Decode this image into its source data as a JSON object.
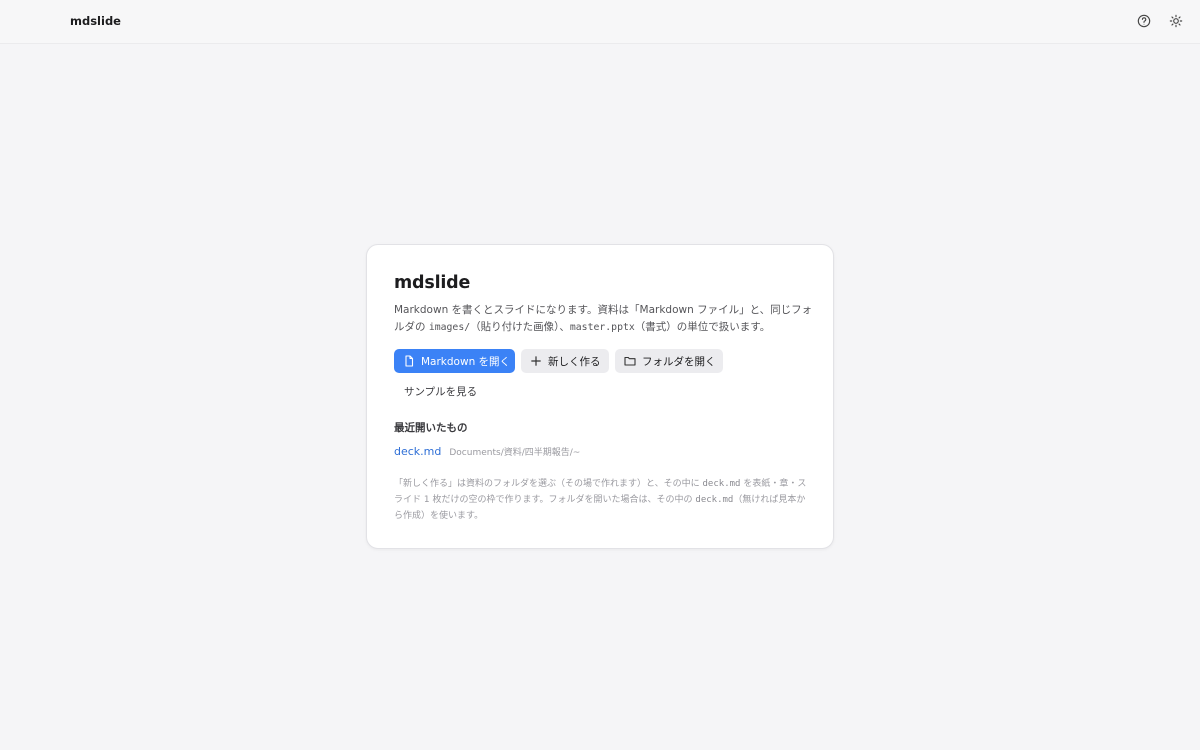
{
  "header": {
    "app_title": "mdslide",
    "icons": [
      "help-circle-icon",
      "sun-icon"
    ]
  },
  "card": {
    "title": "mdslide",
    "description": {
      "part1": "Markdown を書くとスライドになります。資料は「Markdown ファイル」と、同じフォルダの ",
      "code1": "images/",
      "part2": "（貼り付けた画像）、",
      "code2": "master.pptx",
      "part3": "（書式）の単位で扱います。"
    },
    "buttons": {
      "open_markdown": "Markdown を開く",
      "new": "新しく作る",
      "open_folder": "フォルダを開く",
      "view_sample": "サンプルを見る"
    },
    "recent": {
      "title": "最近開いたもの",
      "items": [
        {
          "name": "deck.md",
          "path": "Documents/資料/四半期報告/~"
        }
      ]
    },
    "note": {
      "part1": "「新しく作る」は資料のフォルダを選ぶ（その場で作れます）と、その中に ",
      "code1": "deck.md",
      "part2": " を表紙・章・スライド 1 枚だけの空の枠で作ります。フォルダを開いた場合は、その中の ",
      "code2": "deck.md",
      "part3": "（無ければ見本から作成）を使います。"
    }
  },
  "colors": {
    "background": "#f5f5f7",
    "primary": "#3b82f6",
    "link": "#2f6fd6"
  }
}
